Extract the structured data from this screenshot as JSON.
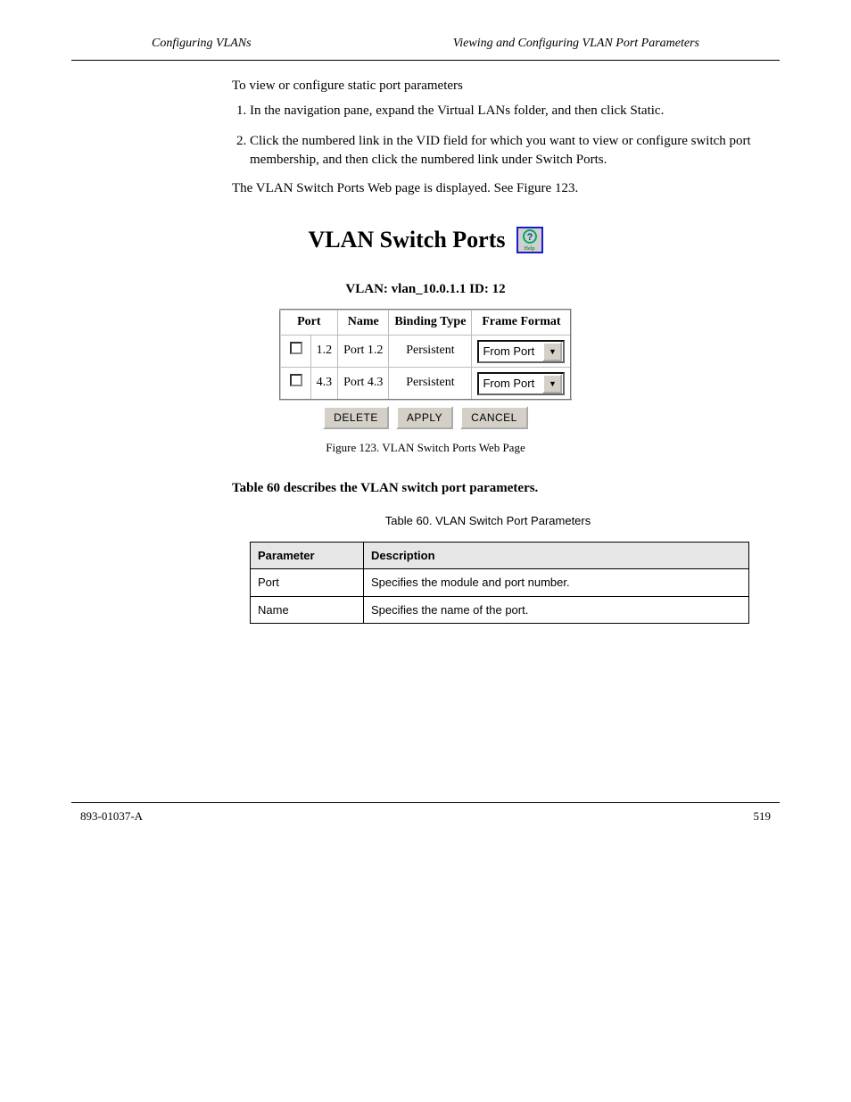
{
  "header": {
    "left": "Configuring VLANs",
    "right": "Viewing and Configuring VLAN Port Parameters"
  },
  "intro": {
    "line1": "To view or configure static port parameters",
    "steps": [
      "In the navigation pane, expand the Virtual LANs folder, and then click Static.",
      "Click the numbered link in the VID field for which you want to view or configure switch port membership, and then click the numbered link under Switch Ports."
    ],
    "after": "The VLAN Switch Ports Web page is displayed. See Figure 123."
  },
  "figure": {
    "title": "VLAN Switch Ports",
    "subtitle": "VLAN: vlan_10.0.1.1 ID: 12",
    "help_icon_name": "help-icon",
    "table": {
      "headers": [
        "Port",
        "Name",
        "Binding Type",
        "Frame Format"
      ],
      "rows": [
        {
          "checked": false,
          "port": "1.2",
          "name": "Port 1.2",
          "binding": "Persistent",
          "format": "From Port"
        },
        {
          "checked": false,
          "port": "4.3",
          "name": "Port 4.3",
          "binding": "Persistent",
          "format": "From Port"
        }
      ]
    },
    "buttons": {
      "delete": "DELETE",
      "apply": "APPLY",
      "cancel": "CANCEL"
    },
    "caption": "Figure 123. VLAN Switch Ports Web Page"
  },
  "section_sub": "Table 60 describes the VLAN switch port parameters.",
  "param_table": {
    "title": "Table 60. VLAN Switch Port Parameters",
    "headers": [
      "Parameter",
      "Description"
    ],
    "rows": [
      [
        "Port",
        "Specifies the module and port number."
      ],
      [
        "Name",
        "Specifies the name of the port."
      ]
    ]
  },
  "footer": {
    "left": "893-01037-A",
    "right": "519"
  }
}
